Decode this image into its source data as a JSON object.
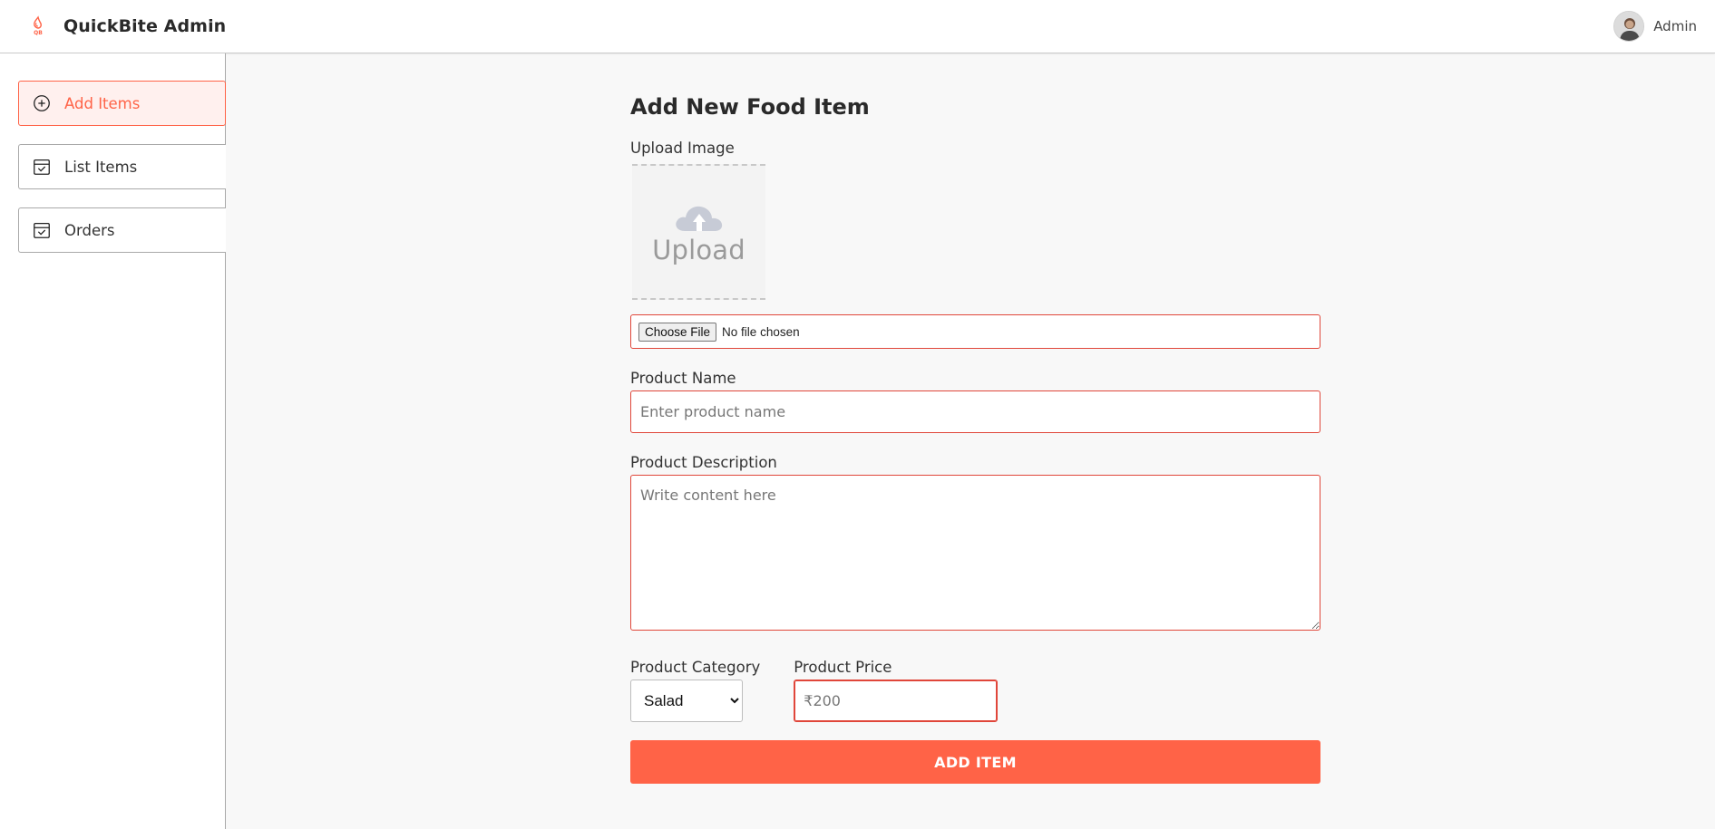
{
  "colors": {
    "accent": "#ff6347",
    "input_border": "#e0463a",
    "active_bg": "#fff0ee"
  },
  "navbar": {
    "title": "QuickBite Admin",
    "logo_icon": "quickbite-logo-icon",
    "profile_name": "Admin"
  },
  "sidebar": {
    "items": [
      {
        "label": "Add Items",
        "icon": "plus-circle-icon",
        "active": true
      },
      {
        "label": "List Items",
        "icon": "calendar-check-icon",
        "active": false
      },
      {
        "label": "Orders",
        "icon": "calendar-check-icon",
        "active": false
      }
    ]
  },
  "form": {
    "title": "Add New Food Item",
    "upload_label": "Upload Image",
    "upload_placeholder": "Upload",
    "file_button": "Choose File",
    "file_status": "No file chosen",
    "name_label": "Product Name",
    "name_placeholder": "Enter product name",
    "description_label": "Product Description",
    "description_placeholder": "Write content here",
    "category_label": "Product Category",
    "category_value": "Salad",
    "price_label": "Product Price",
    "price_placeholder": "₹200",
    "submit_label": "ADD ITEM"
  }
}
